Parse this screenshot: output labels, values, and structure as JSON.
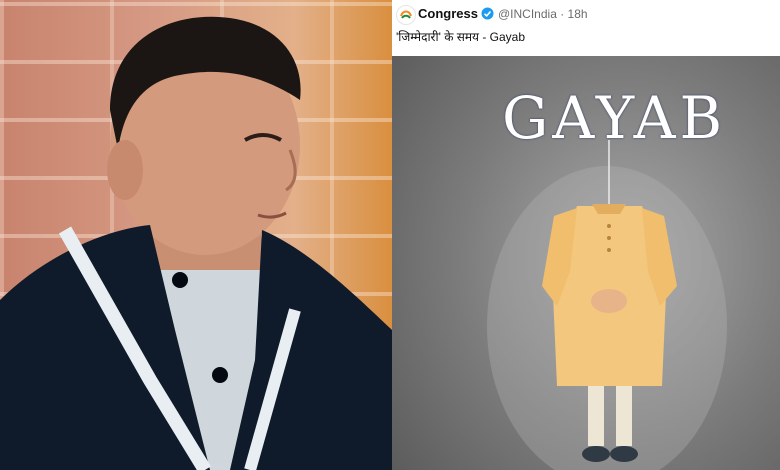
{
  "tweet": {
    "account_name": "Congress",
    "handle_time": "@INCIndia · 18h",
    "text": "'जिम्मेदारी' के समय - Gayab"
  },
  "poster": {
    "title": "GAYAB"
  },
  "icons": {
    "avatar": "congress-logo-icon",
    "verified": "verified-badge-icon"
  },
  "colors": {
    "verified_blue": "#1d9bf0",
    "poster_background": "#7c7c7c",
    "kurta": "#f3c77d"
  }
}
